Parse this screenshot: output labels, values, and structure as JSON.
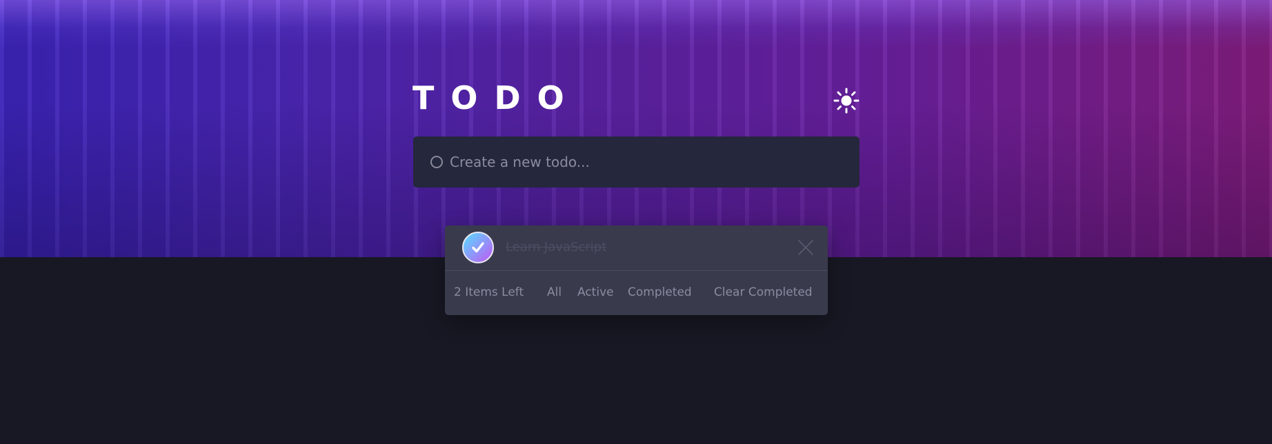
{
  "app": {
    "title": "TODO"
  },
  "theme_toggle": {
    "icon": "sun-icon"
  },
  "new_todo": {
    "placeholder": "Create a new todo...",
    "value": ""
  },
  "todos": [
    {
      "text": "Learn JavaScript",
      "completed": true
    }
  ],
  "footer": {
    "items_left": "2 Items Left",
    "filter_all": "All",
    "filter_active": "Active",
    "filter_completed": "Completed",
    "clear_completed": "Clear Completed"
  },
  "colors": {
    "page_background": "#181824",
    "card_background": "#25273c",
    "list_background": "#393a4c",
    "check_gradient_start": "#57ddff",
    "check_gradient_end": "#c058f3"
  }
}
